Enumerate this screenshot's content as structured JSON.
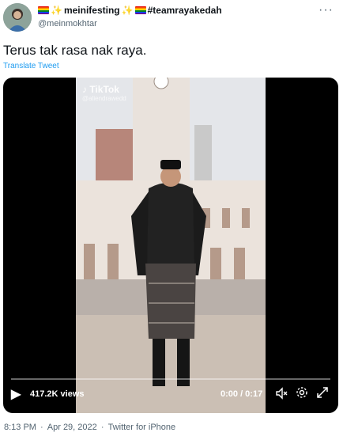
{
  "author": {
    "display_name": "meinifesting",
    "hashtag": "#teamrayakedah",
    "handle": "@meinmokhtar"
  },
  "more_icon": "more-dots-icon",
  "tweet": {
    "text": "Terus tak rasa nak raya.",
    "translate_label": "Translate Tweet"
  },
  "video": {
    "watermark": "TikTok",
    "watermark_user": "@aliendrawedd",
    "views": "417.2K views",
    "time": "0:00 / 0:17",
    "icons": [
      "play-icon",
      "mute-icon",
      "settings-icon",
      "fullscreen-icon"
    ],
    "progress": 0.0
  },
  "footer": {
    "time": "8:13 PM",
    "date": "Apr 29, 2022",
    "source": "Twitter for iPhone"
  },
  "colors": {
    "link": "#1d9bf0",
    "secondary": "#536471"
  }
}
